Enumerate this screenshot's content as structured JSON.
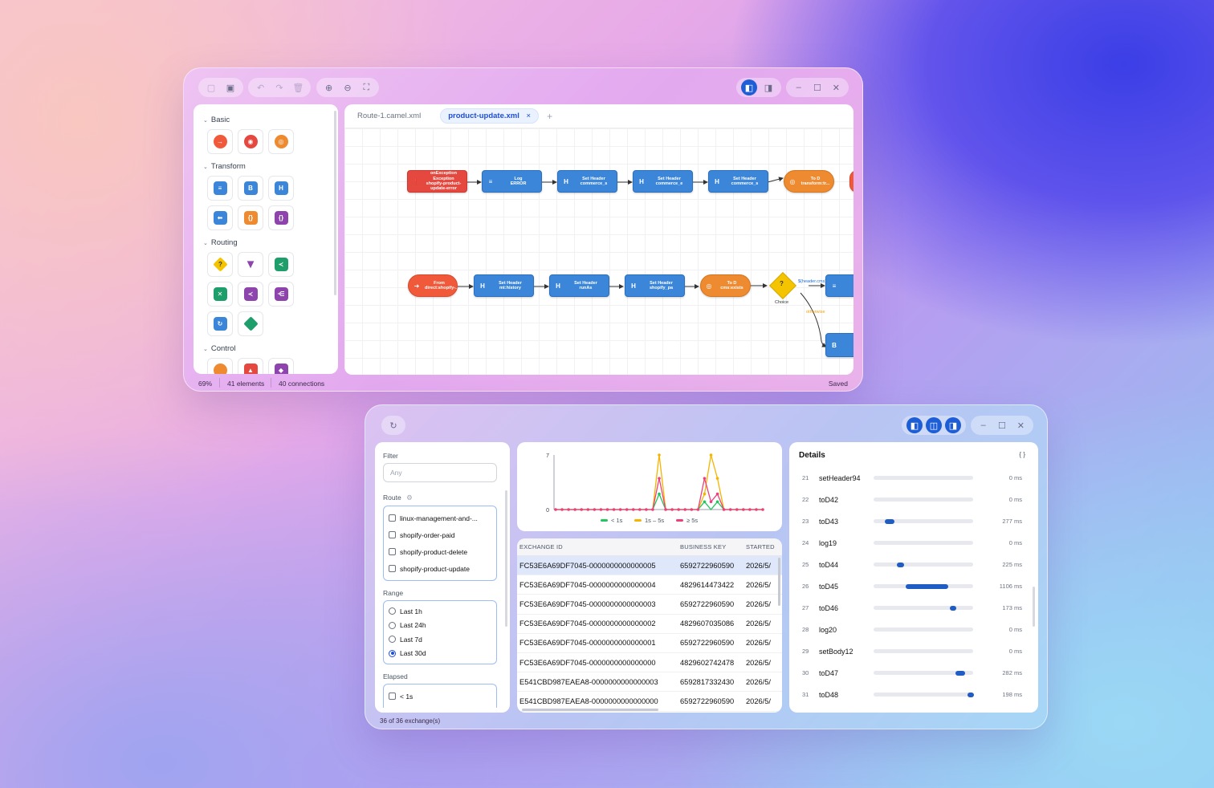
{
  "editor": {
    "tabs": [
      "Route-1.camel.xml",
      "product-update.xml"
    ],
    "active_tab_close": "×",
    "add_tab": "+",
    "palette": {
      "categories": [
        "Basic",
        "Transform",
        "Routing",
        "Control"
      ]
    },
    "nodes": {
      "onexception": "onException\nException\nshopify-product-update-error",
      "log": "Log\nERROR",
      "sh1": "Set Header\ncommerce_s",
      "sh2": "Set Header\ncommerce_e",
      "sh3": "Set Header\ncommerce_s",
      "tod1": "To D\ntransform:tr...",
      "from": "From\ndirect:shopify-...",
      "sh4": "Set Header\nmt:history",
      "sh5": "Set Header\nrunAs",
      "sh6": "Set Header\nshopify_pa",
      "tod2": "To D\ncms:exists",
      "choice_label": "Choice",
      "when_label": "${header.cms}",
      "otherwise_label": "otherwise"
    },
    "status": {
      "zoom": "69%",
      "elements": "41 elements",
      "connections": "40 connections",
      "saved": "Saved"
    }
  },
  "monitor": {
    "filter_label": "Filter",
    "filter_placeholder": "Any",
    "route_label": "Route",
    "routes": [
      "linux-management-and-...",
      "shopify-order-paid",
      "shopify-product-delete",
      "shopify-product-update"
    ],
    "range_label": "Range",
    "ranges": [
      "Last 1h",
      "Last 24h",
      "Last 7d",
      "Last 30d"
    ],
    "range_selected": 3,
    "elapsed_label": "Elapsed",
    "elapsed_first": "< 1s",
    "footer": "36 of 36 exchange(s)",
    "details_title": "Details",
    "details_icon": "{ }",
    "table": {
      "headers": [
        "EXCHANGE ID",
        "BUSINESS KEY",
        "STARTED"
      ],
      "rows": [
        [
          "FC53E6A69DF7045-0000000000000005",
          "6592722960590",
          "2026/5/"
        ],
        [
          "FC53E6A69DF7045-0000000000000004",
          "4829614473422",
          "2026/5/"
        ],
        [
          "FC53E6A69DF7045-0000000000000003",
          "6592722960590",
          "2026/5/"
        ],
        [
          "FC53E6A69DF7045-0000000000000002",
          "4829607035086",
          "2026/5/"
        ],
        [
          "FC53E6A69DF7045-0000000000000001",
          "6592722960590",
          "2026/5/"
        ],
        [
          "FC53E6A69DF7045-0000000000000000",
          "4829602742478",
          "2026/5/"
        ],
        [
          "E541CBD987EAEA8-0000000000000003",
          "6592817332430",
          "2026/5/"
        ],
        [
          "E541CBD987EAEA8-0000000000000000",
          "6592722960590",
          "2026/5/"
        ]
      ]
    },
    "details": [
      {
        "n": "21",
        "name": "setHeader94",
        "ms": "0 ms",
        "start": 0,
        "frac": 0
      },
      {
        "n": "22",
        "name": "toD42",
        "ms": "0 ms",
        "start": 0,
        "frac": 0
      },
      {
        "n": "23",
        "name": "toD43",
        "ms": "277 ms",
        "start": 0.11,
        "frac": 0.1
      },
      {
        "n": "24",
        "name": "log19",
        "ms": "0 ms",
        "start": 0,
        "frac": 0
      },
      {
        "n": "25",
        "name": "toD44",
        "ms": "225 ms",
        "start": 0.23,
        "frac": 0.08
      },
      {
        "n": "26",
        "name": "toD45",
        "ms": "1106 ms",
        "start": 0.32,
        "frac": 0.43
      },
      {
        "n": "27",
        "name": "toD46",
        "ms": "173 ms",
        "start": 0.77,
        "frac": 0.06
      },
      {
        "n": "28",
        "name": "log20",
        "ms": "0 ms",
        "start": 0,
        "frac": 0
      },
      {
        "n": "29",
        "name": "setBody12",
        "ms": "0 ms",
        "start": 0,
        "frac": 0
      },
      {
        "n": "30",
        "name": "toD47",
        "ms": "282 ms",
        "start": 0.82,
        "frac": 0.1
      },
      {
        "n": "31",
        "name": "toD48",
        "ms": "198 ms",
        "start": 0.94,
        "frac": 0.07
      }
    ]
  },
  "chart_data": {
    "type": "line",
    "ylim": [
      0,
      7
    ],
    "yticks": [
      "7",
      "0"
    ],
    "points": 33,
    "series": [
      {
        "name": "< 1s",
        "color": "#22c55e",
        "values": [
          0,
          0,
          0,
          0,
          0,
          0,
          0,
          0,
          0,
          0,
          0,
          0,
          0,
          0,
          0,
          0,
          2,
          0,
          0,
          0,
          0,
          0,
          0,
          1,
          0,
          1,
          0,
          0,
          0,
          0,
          0,
          0,
          0
        ]
      },
      {
        "name": "1s – 5s",
        "color": "#f5b400",
        "values": [
          0,
          0,
          0,
          0,
          0,
          0,
          0,
          0,
          0,
          0,
          0,
          0,
          0,
          0,
          0,
          0,
          7,
          0,
          0,
          0,
          0,
          0,
          0,
          2,
          7,
          4,
          0,
          0,
          0,
          0,
          0,
          0,
          0
        ]
      },
      {
        "name": "≥ 5s",
        "color": "#ec407a",
        "values": [
          0,
          0,
          0,
          0,
          0,
          0,
          0,
          0,
          0,
          0,
          0,
          0,
          0,
          0,
          0,
          0,
          4,
          0,
          0,
          0,
          0,
          0,
          0,
          4,
          1,
          2,
          0,
          0,
          0,
          0,
          0,
          0,
          0
        ]
      }
    ]
  }
}
